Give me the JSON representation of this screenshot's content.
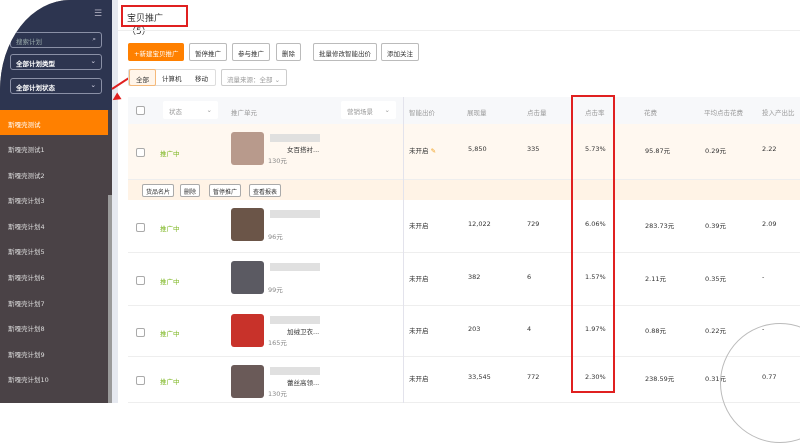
{
  "sidebar": {
    "search_placeholder": "搜索计划",
    "type_select": "全部计划类型",
    "state_select": "全部计划状态",
    "items": [
      "斯嘎壳测试",
      "斯嘎壳测试1",
      "斯嘎壳测试2",
      "斯嘎壳计划3",
      "斯嘎壳计划4",
      "斯嘎壳计划5",
      "斯嘎壳计划6",
      "斯嘎壳计划7",
      "斯嘎壳计划8",
      "斯嘎壳计划9",
      "斯嘎壳计划10"
    ]
  },
  "header": {
    "title": "宝贝推广（5）"
  },
  "toolbar": [
    "+新建宝贝推广",
    "暂停推广",
    "参与推广",
    "删除",
    "批量修改智能出价",
    "添加关注"
  ],
  "tabs": [
    "全部",
    "计算机",
    "移动"
  ],
  "traffic_filter": "流量来源：全部",
  "table": {
    "headers": {
      "status": "状态",
      "unit": "推广单元",
      "scene": "营销场景",
      "bid": "智能出价",
      "impressions": "展现量",
      "clicks": "点击量",
      "ctr": "点击率",
      "cost": "花费",
      "cpc": "平均点击花费",
      "roi": "投入产出比"
    },
    "row_actions": [
      "货品名片",
      "删除",
      "暂停推广",
      "查看报表"
    ],
    "rows": [
      {
        "status": "推广中",
        "name": "女百搭衬...",
        "price": "130元",
        "bid": "未开启",
        "impressions": "5,850",
        "clicks": "335",
        "ctr": "5.73%",
        "cost": "95.87元",
        "cpc": "0.29元",
        "roi": "2.22",
        "img": "#b89a8c"
      },
      {
        "status": "推广中",
        "name": "",
        "price": "96元",
        "bid": "未开启",
        "impressions": "12,022",
        "clicks": "729",
        "ctr": "6.06%",
        "cost": "283.73元",
        "cpc": "0.39元",
        "roi": "2.09",
        "img": "#6b5548"
      },
      {
        "status": "推广中",
        "name": "",
        "price": "99元",
        "bid": "未开启",
        "impressions": "382",
        "clicks": "6",
        "ctr": "1.57%",
        "cost": "2.11元",
        "cpc": "0.35元",
        "roi": "-",
        "img": "#5b5a62"
      },
      {
        "status": "推广中",
        "name": "加绒卫衣...",
        "price": "165元",
        "bid": "未开启",
        "impressions": "203",
        "clicks": "4",
        "ctr": "1.97%",
        "cost": "0.88元",
        "cpc": "0.22元",
        "roi": "-",
        "img": "#c8322a"
      },
      {
        "status": "推广中",
        "name": "蕾丝高领...",
        "price": "130元",
        "bid": "未开启",
        "impressions": "33,545",
        "clicks": "772",
        "ctr": "2.30%",
        "cost": "238.59元",
        "cpc": "0.31元",
        "roi": "0.77",
        "img": "#6a5a58"
      }
    ]
  }
}
